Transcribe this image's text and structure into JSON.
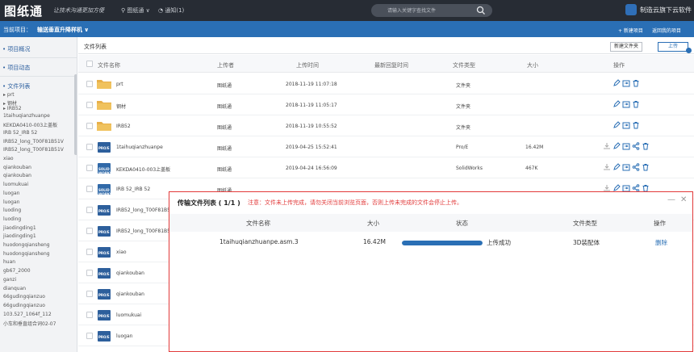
{
  "topbar": {
    "logo": "图纸通",
    "slogan": "让技术沟通更加方便",
    "user": "图纸通 ∨",
    "notice": "通知(1)",
    "search_placeholder": "请输入关键字查找文件",
    "brand": "制造云旗下云软件"
  },
  "project": {
    "label": "当前项目：",
    "name": "输送垂直升降样机 ∨",
    "new_project": "+ 新建项目",
    "back": "返回我的项目"
  },
  "sidebar": {
    "overview": "项目概况",
    "activity": "项目动态",
    "filelist": "文件列表",
    "folders": [
      "prt",
      "钢材",
      "IRB52"
    ],
    "files": [
      "1taihuqianzhuanpe",
      "KEKDA0410-003上盖板",
      "IRB 52_IRB 52",
      "IRB52_long_T00F81B51V",
      "IRB52_long_T00F81B51V",
      "xiao",
      "qiankouban",
      "qiankouban",
      "luomukuai",
      "luogan",
      "luogan",
      "luoding",
      "luoding",
      "jiaodingding1",
      "jiaodingding1",
      "huodongqiansheng",
      "huodongqiansheng",
      "huan",
      "gb67_2000",
      "ganzi",
      "dianquan",
      "66gudingqianzuo",
      "66gudingqianzuo",
      "103.527_1064f_112",
      "小车和垂直组合词02-07"
    ]
  },
  "main": {
    "title": "文件列表",
    "new_folder": "新建文件夹",
    "upload": "上传",
    "headers": {
      "name": "文件名称",
      "uploader": "上传者",
      "upload_time": "上传时间",
      "latest_reply": "最新回复时间",
      "type": "文件类型",
      "size": "大小",
      "ops": "操作"
    },
    "rows": [
      {
        "name": "prt",
        "uploader": "图纸通",
        "time": "2018-11-19 11:07:18",
        "type": "文件夹",
        "size": ""
      },
      {
        "name": "钢材",
        "uploader": "图纸通",
        "time": "2018-11-19 11:05:17",
        "type": "文件夹",
        "size": ""
      },
      {
        "name": "IRB52",
        "uploader": "图纸通",
        "time": "2018-11-19 10:55:52",
        "type": "文件夹",
        "size": ""
      },
      {
        "name": "1taihuqianzhuanpe",
        "uploader": "图纸通",
        "time": "2019-04-25 15:52:41",
        "type": "Pro/E",
        "size": "16.42M"
      },
      {
        "name": "KEKDA0410-003上盖板",
        "uploader": "图纸通",
        "time": "2019-04-24 16:56:09",
        "type": "SolidWorks",
        "size": "467K"
      },
      {
        "name": "IRB 52_IRB 52",
        "uploader": "图纸通",
        "time": "",
        "type": "",
        "size": ""
      },
      {
        "name": "IRB52_long_T00F81B5",
        "uploader": "",
        "time": "",
        "type": "",
        "size": ""
      },
      {
        "name": "IRB52_long_T00F81B5",
        "uploader": "",
        "time": "",
        "type": "",
        "size": ""
      },
      {
        "name": "xiao",
        "uploader": "",
        "time": "",
        "type": "",
        "size": ""
      },
      {
        "name": "qiankouban",
        "uploader": "",
        "time": "",
        "type": "",
        "size": ""
      },
      {
        "name": "qiankouban",
        "uploader": "",
        "time": "",
        "type": "",
        "size": ""
      },
      {
        "name": "luomukuai",
        "uploader": "",
        "time": "",
        "type": "",
        "size": ""
      },
      {
        "name": "luogan",
        "uploader": "",
        "time": "",
        "type": "",
        "size": ""
      }
    ],
    "file_badges": {
      "proe": "PRO/E",
      "solidworks": "SOLID WORKS"
    }
  },
  "dialog": {
    "title": "传输文件列表 ( 1/1 )",
    "warning": "注意：文件未上传完成，请勿关闭当前浏览页面，否则上传未完成的文件会停止上传。",
    "minimize": "—",
    "close": "✕",
    "headers": {
      "name": "文件名称",
      "size": "大小",
      "status": "状态",
      "type": "文件类型",
      "ops": "操作"
    },
    "row": {
      "name": "1taihuqianzhuanpe.asm.3",
      "size": "16.42M",
      "progress": 1.0,
      "status": "上传成功",
      "type": "3D装配体",
      "delete": "删除"
    }
  },
  "colors": {
    "topbar": "#272c34",
    "project_bar": "#2a6fb5",
    "accent": "#2a6fb5",
    "warning": "#e23a3a",
    "folder": "#e8b04a"
  }
}
